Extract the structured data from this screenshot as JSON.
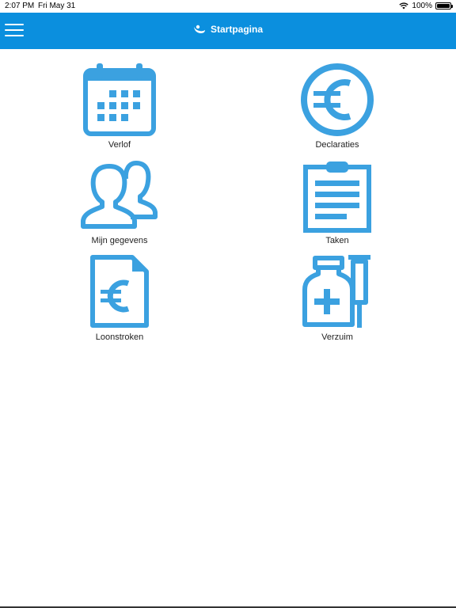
{
  "status": {
    "time": "2:07 PM",
    "date": "Fri May 31",
    "battery": "100%"
  },
  "header": {
    "title": "Startpagina"
  },
  "colors": {
    "accent": "#0b8fde",
    "icon": "#3ba1e0"
  },
  "tiles": [
    {
      "label": "Verlof",
      "icon": "calendar-icon"
    },
    {
      "label": "Declaraties",
      "icon": "euro-coin-icon"
    },
    {
      "label": "Mijn gegevens",
      "icon": "people-icon"
    },
    {
      "label": "Taken",
      "icon": "clipboard-icon"
    },
    {
      "label": "Loonstroken",
      "icon": "euro-document-icon"
    },
    {
      "label": "Verzuim",
      "icon": "medicine-icon"
    }
  ]
}
